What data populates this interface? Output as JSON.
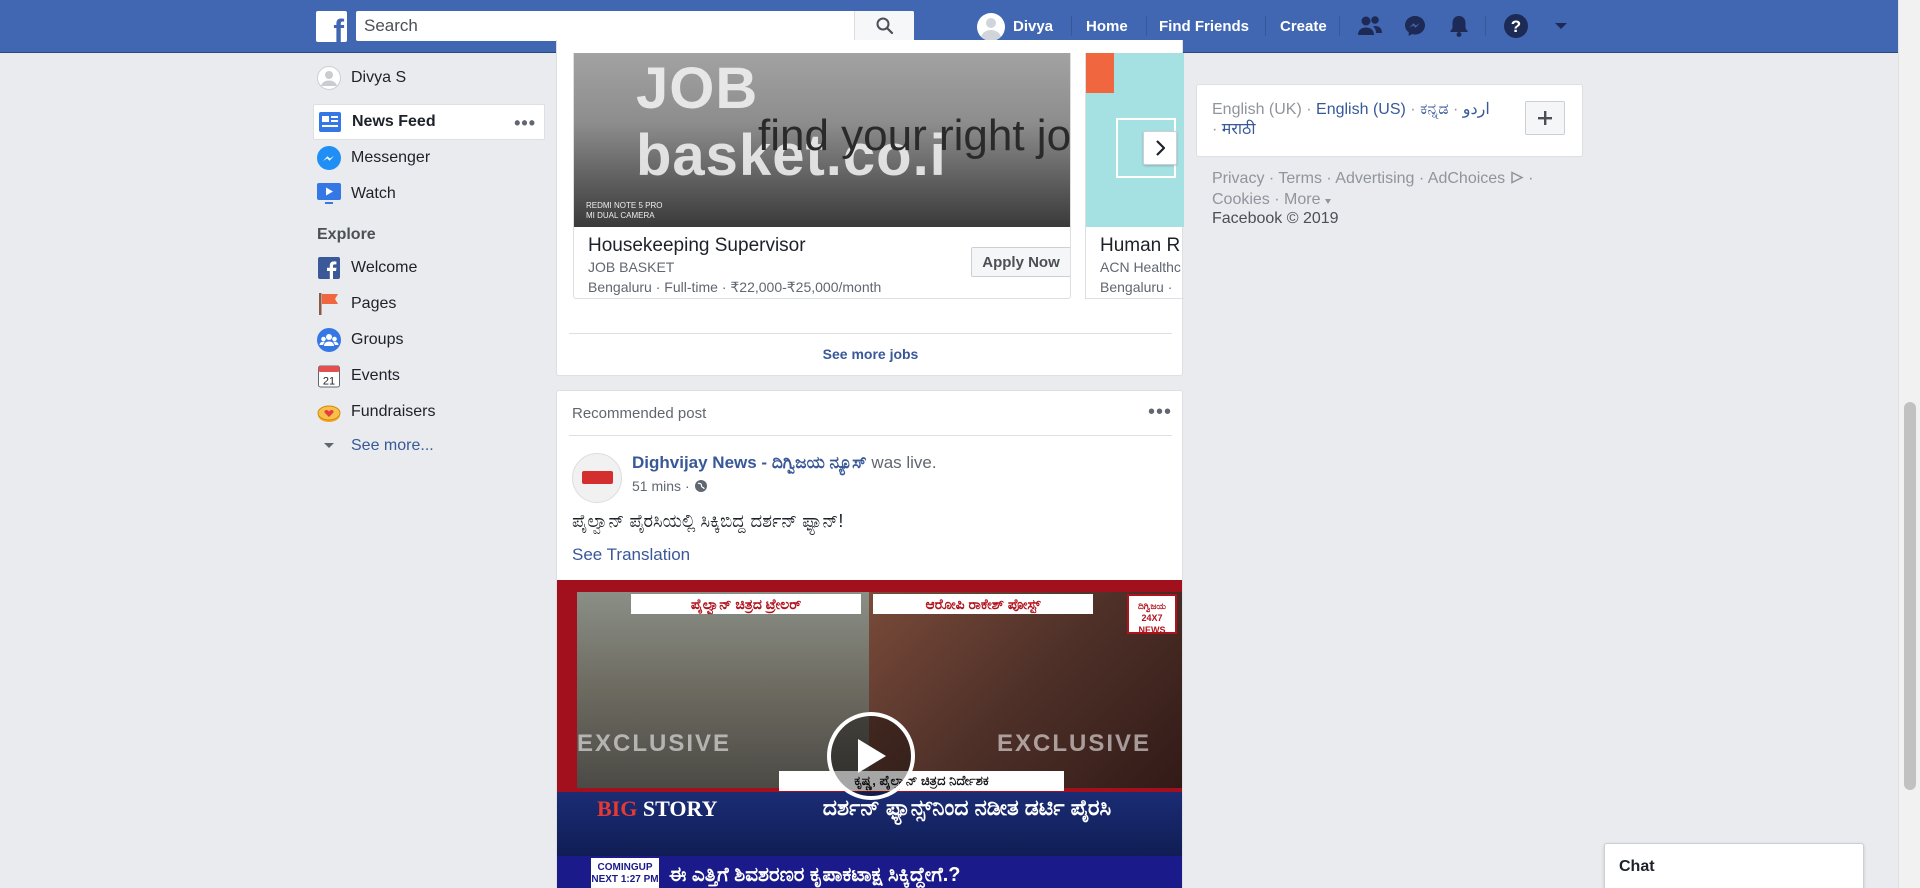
{
  "topbar": {
    "search_placeholder": "Search",
    "user_name": "Divya",
    "nav": {
      "home": "Home",
      "find_friends": "Find Friends",
      "create": "Create"
    },
    "icons": [
      "friend-requests-icon",
      "messenger-icon",
      "notifications-icon",
      "help-icon",
      "account-menu-icon"
    ]
  },
  "left_sidebar": {
    "profile_name": "Divya S",
    "items": [
      {
        "label": "News Feed",
        "icon": "news-feed-icon",
        "active": true
      },
      {
        "label": "Messenger",
        "icon": "messenger-icon"
      },
      {
        "label": "Watch",
        "icon": "watch-icon"
      }
    ],
    "explore_header": "Explore",
    "explore_items": [
      {
        "label": "Welcome",
        "icon": "facebook-icon"
      },
      {
        "label": "Pages",
        "icon": "pages-flag-icon"
      },
      {
        "label": "Groups",
        "icon": "groups-icon"
      },
      {
        "label": "Events",
        "icon": "calendar-icon",
        "date": "21"
      },
      {
        "label": "Fundraisers",
        "icon": "fundraiser-icon"
      }
    ],
    "see_more": "See more..."
  },
  "jobs": {
    "job1": {
      "image_text_1": "JOB basket.co.i",
      "image_text_2": "find your right jo",
      "image_text_3": "REDMI NOTE 5 PRO\nMI DUAL CAMERA",
      "title": "Housekeeping Supervisor",
      "company": "JOB BASKET",
      "meta": "Bengaluru · Full-time · ₹22,000-₹25,000/month",
      "apply_label": "Apply Now"
    },
    "job2": {
      "title": "Human R",
      "company": "ACN Healthc",
      "meta": "Bengaluru ·"
    },
    "see_more_label": "See more jobs"
  },
  "post": {
    "header_label": "Recommended post",
    "author": "Dighvijay News - ದಿಗ್ವಿಜಯ ನ್ಯೂಸ್",
    "action": "was live.",
    "time": "51 mins",
    "text": "ಪೈಲ್ವಾನ್ ಪೈರಸಿಯಲ್ಲಿ ಸಿಕ್ಕಿಬಿದ್ದ ದರ್ಶನ್ ಫ್ಯಾನ್!",
    "see_translation": "See Translation",
    "video": {
      "banner_left": "ಪೈಲ್ವಾನ್ ಚಿತ್ರದ ಟ್ರೇಲರ್",
      "banner_right": "ಆರೋಪಿ ರಾಕೇಶ್ ಪೋಸ್ಟ್",
      "logo_text": "ದಿಗ್ವಿಜಯ 24X7 NEWS",
      "exclusive": "EXCLUSIVE",
      "caption": "ಕೃಷ್ಣ, ಪೈಲ್ವಾನ್ ಚಿತ್ರದ ನಿರ್ದೇಶಕ",
      "big_label": "BIG",
      "story_label": "STORY",
      "headline": "ದರ್ಶನ್ ಫ್ಯಾನ್ಸ್‌ನಿಂದ ನಡೀತ ಡರ್ಟಿ ಪೈರಸಿ",
      "ticker_label": "COMINGUP NEXT 1:27 PM",
      "ticker_text": "ಈ ಎತ್ತಿಗೆ ಶಿವಶರಣರ ಕೃಪಾಕಟಾಕ್ಷ ಸಿಕ್ಕಿದ್ದೇಗೆ.?"
    }
  },
  "right_column": {
    "languages": {
      "current": "English (UK)",
      "options": [
        "English (US)",
        "ಕನ್ನಡ",
        "اردو",
        "मराठी"
      ]
    },
    "footer_links": [
      "Privacy",
      "Terms",
      "Advertising",
      "AdChoices",
      "Cookies",
      "More"
    ],
    "copyright": "Facebook © 2019"
  },
  "chat": {
    "label": "Chat"
  },
  "colors": {
    "brand_blue": "#4267b2",
    "link_blue": "#385898",
    "background": "#e9ebee"
  }
}
